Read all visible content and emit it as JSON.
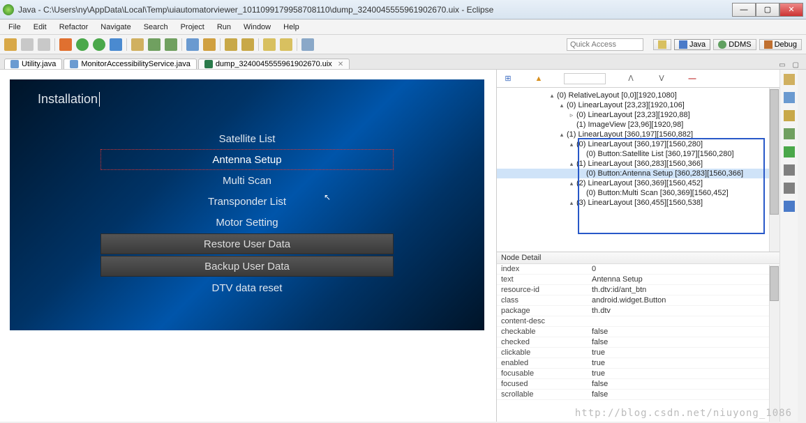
{
  "window": {
    "title": "Java - C:\\Users\\ny\\AppData\\Local\\Temp\\uiautomatorviewer_1011099179958708110\\dump_3240045555961902670.uix - Eclipse"
  },
  "menu": {
    "items": [
      "File",
      "Edit",
      "Refactor",
      "Navigate",
      "Search",
      "Project",
      "Run",
      "Window",
      "Help"
    ]
  },
  "quick_access_placeholder": "Quick Access",
  "perspectives": {
    "java": "Java",
    "ddms": "DDMS",
    "debug": "Debug"
  },
  "tabs": [
    {
      "label": "Utility.java",
      "icon": "#6b9bd1"
    },
    {
      "label": "MonitorAccessibilityService.java",
      "icon": "#6b9bd1"
    },
    {
      "label": "dump_3240045555961902670.uix",
      "icon": "#2a7a4a",
      "active": true
    }
  ],
  "device": {
    "title": "Installation",
    "items": [
      {
        "label": "Satellite List",
        "kind": "text"
      },
      {
        "label": "Antenna Setup",
        "kind": "selected"
      },
      {
        "label": "Multi Scan",
        "kind": "text"
      },
      {
        "label": "Transponder List",
        "kind": "text"
      },
      {
        "label": "Motor Setting",
        "kind": "text"
      },
      {
        "label": "Restore User Data",
        "kind": "button"
      },
      {
        "label": "Backup User Data",
        "kind": "button"
      },
      {
        "label": "DTV data reset",
        "kind": "text"
      }
    ]
  },
  "tree": [
    {
      "indent": 1,
      "tw": "▴",
      "label": "(0) RelativeLayout [0,0][1920,1080]"
    },
    {
      "indent": 2,
      "tw": "▴",
      "label": "(0) LinearLayout [23,23][1920,106]"
    },
    {
      "indent": 3,
      "tw": "▹",
      "label": "(0) LinearLayout [23,23][1920,88]"
    },
    {
      "indent": 3,
      "tw": "",
      "label": "(1) ImageView [23,96][1920,98]"
    },
    {
      "indent": 2,
      "tw": "▴",
      "label": "(1) LinearLayout [360,197][1560,882]"
    },
    {
      "indent": 3,
      "tw": "▴",
      "label": "(0) LinearLayout [360,197][1560,280]",
      "box": true
    },
    {
      "indent": 4,
      "tw": "",
      "label": "(0) Button:Satellite List [360,197][1560,280]",
      "box": true
    },
    {
      "indent": 3,
      "tw": "▴",
      "label": "(1) LinearLayout [360,283][1560,366]",
      "box": true
    },
    {
      "indent": 4,
      "tw": "",
      "label": "(0) Button:Antenna Setup [360,283][1560,366]",
      "sel": true,
      "box": true
    },
    {
      "indent": 3,
      "tw": "▴",
      "label": "(2) LinearLayout [360,369][1560,452]",
      "box": true
    },
    {
      "indent": 4,
      "tw": "",
      "label": "(0) Button:Multi Scan [360,369][1560,452]",
      "box": true
    },
    {
      "indent": 3,
      "tw": "▴",
      "label": "(3) LinearLayout [360,455][1560,538]",
      "box": true
    }
  ],
  "detail_header": "Node Detail",
  "detail": [
    {
      "k": "index",
      "v": "0"
    },
    {
      "k": "text",
      "v": "Antenna Setup"
    },
    {
      "k": "resource-id",
      "v": "th.dtv:id/ant_btn"
    },
    {
      "k": "class",
      "v": "android.widget.Button"
    },
    {
      "k": "package",
      "v": "th.dtv"
    },
    {
      "k": "content-desc",
      "v": ""
    },
    {
      "k": "checkable",
      "v": "false"
    },
    {
      "k": "checked",
      "v": "false"
    },
    {
      "k": "clickable",
      "v": "true"
    },
    {
      "k": "enabled",
      "v": "true"
    },
    {
      "k": "focusable",
      "v": "true"
    },
    {
      "k": "focused",
      "v": "false"
    },
    {
      "k": "scrollable",
      "v": "false"
    }
  ],
  "watermark": "http://blog.csdn.net/niuyong_1086"
}
